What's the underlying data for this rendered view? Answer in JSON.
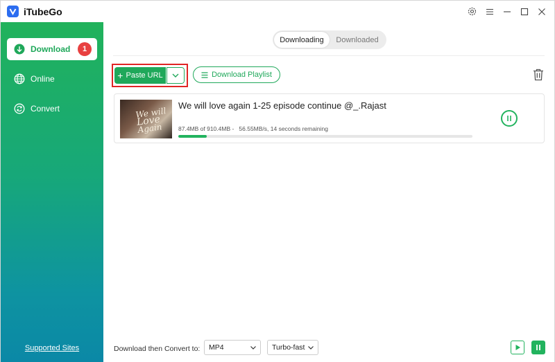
{
  "app": {
    "title": "iTubeGo"
  },
  "colors": {
    "accent": "#1fa85a",
    "badge": "#e84040",
    "highlight": "#e02424"
  },
  "window_controls": [
    "gear-icon",
    "menu-icon",
    "minimize-icon",
    "maximize-icon",
    "close-icon"
  ],
  "sidebar": {
    "items": [
      {
        "label": "Download",
        "icon": "download-icon",
        "badge": "1",
        "active": true
      },
      {
        "label": "Online",
        "icon": "globe-icon"
      },
      {
        "label": "Convert",
        "icon": "convert-icon"
      }
    ],
    "supported_sites": "Supported Sites"
  },
  "tabs": {
    "downloading": "Downloading",
    "downloaded": "Downloaded"
  },
  "toolbar": {
    "paste_url": "Paste URL",
    "download_playlist": "Download Playlist"
  },
  "download": {
    "title": "We will love again 1-25 episode continue @_.Rajast",
    "status": "87.4MB of 910.4MB -   56.55MB/s, 14 seconds remaining",
    "progress_percent": 9.6,
    "thumbnail_text_1": "We will",
    "thumbnail_text_2": "Love",
    "thumbnail_text_3": "Again"
  },
  "bottom": {
    "convert_label": "Download then Convert to:",
    "format": "MP4",
    "speed": "Turbo-fast"
  }
}
